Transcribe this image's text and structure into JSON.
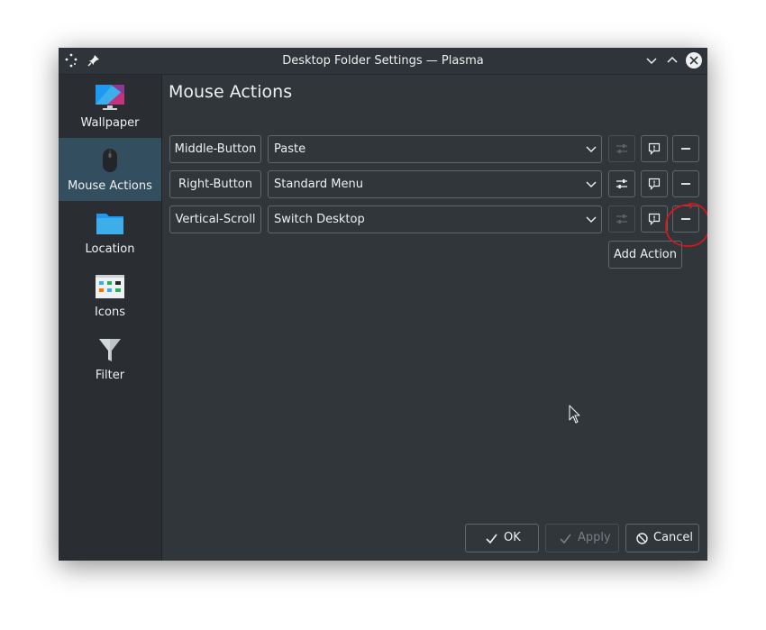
{
  "window": {
    "title": "Desktop Folder Settings — Plasma"
  },
  "sidebar": {
    "items": [
      {
        "label": "Wallpaper",
        "icon": "wallpaper-icon",
        "active": false
      },
      {
        "label": "Mouse Actions",
        "icon": "mouse-icon",
        "active": true
      },
      {
        "label": "Location",
        "icon": "folder-icon",
        "active": false
      },
      {
        "label": "Icons",
        "icon": "icons-view-icon",
        "active": false
      },
      {
        "label": "Filter",
        "icon": "filter-icon",
        "active": false
      }
    ]
  },
  "main": {
    "title": "Mouse Actions",
    "actions": [
      {
        "trigger": "Middle-Button",
        "plugin": "Paste",
        "configure_enabled": false
      },
      {
        "trigger": "Right-Button",
        "plugin": "Standard Menu",
        "configure_enabled": true
      },
      {
        "trigger": "Vertical-Scroll",
        "plugin": "Switch Desktop",
        "configure_enabled": false
      }
    ],
    "add_action_label": "Add Action"
  },
  "footer": {
    "ok_label": "OK",
    "apply_label": "Apply",
    "cancel_label": "Cancel"
  },
  "colors": {
    "window_bg": "#31363b",
    "selection": "#334e5e",
    "text": "#eff0f1",
    "annotation": "#e0151b"
  }
}
